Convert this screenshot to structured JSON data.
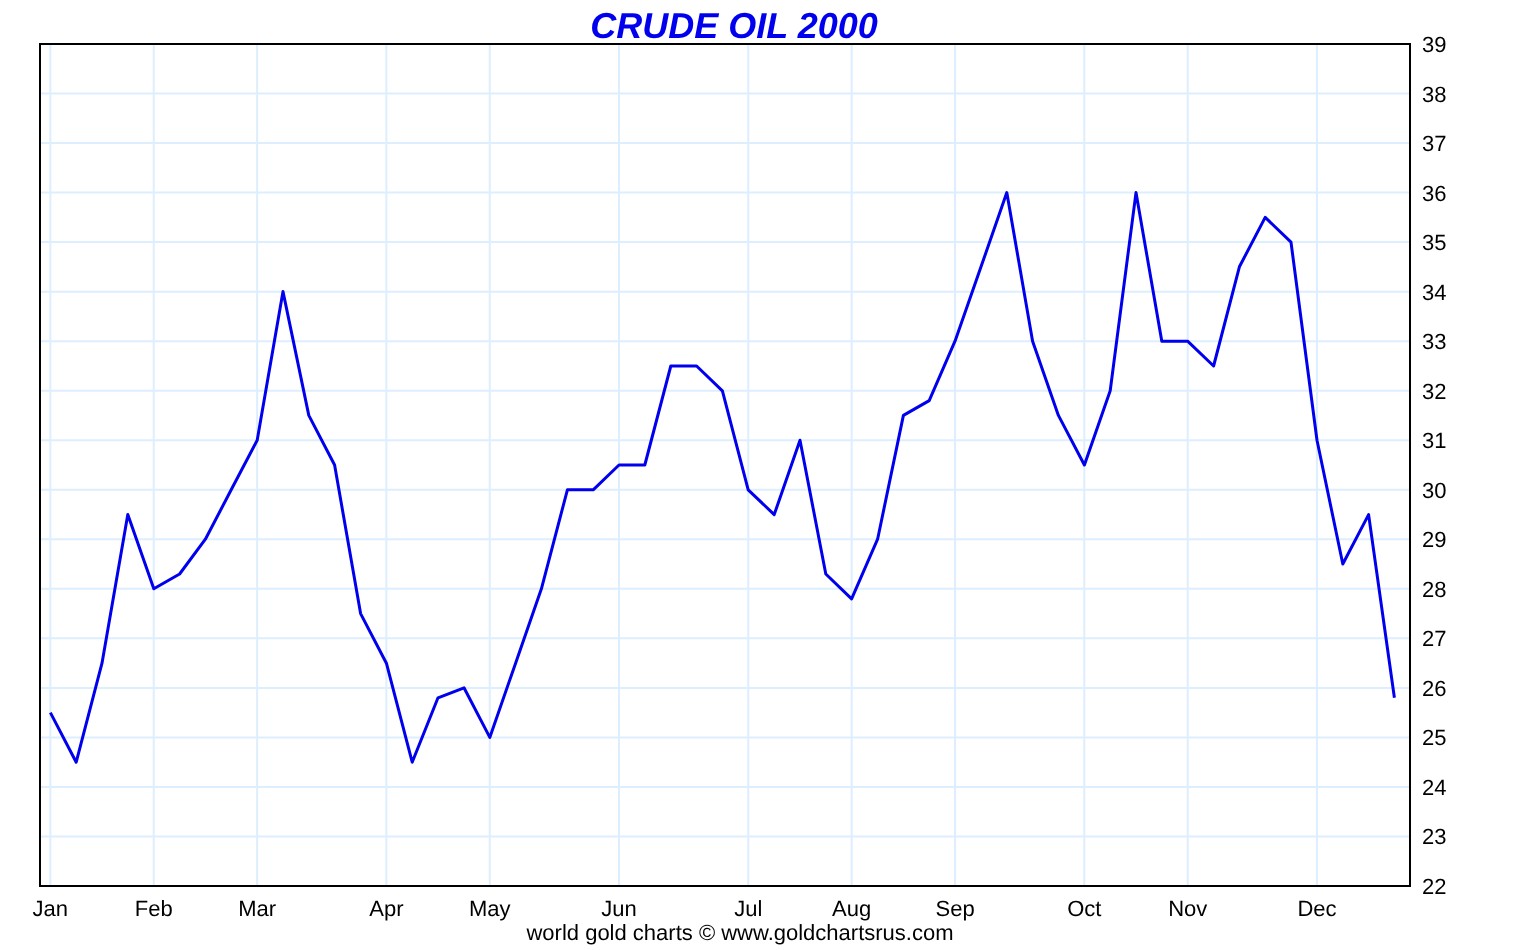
{
  "chart": {
    "chart_data": {
      "type": "line",
      "title": "CRUDE OIL 2000",
      "categories": [
        "Jan",
        null,
        null,
        null,
        "Feb",
        null,
        null,
        null,
        "Mar",
        null,
        null,
        null,
        null,
        "Apr",
        null,
        null,
        null,
        "May",
        null,
        null,
        null,
        null,
        "Jun",
        null,
        null,
        null,
        null,
        "Jul",
        null,
        null,
        null,
        "Aug",
        null,
        null,
        null,
        "Sep",
        null,
        null,
        null,
        null,
        "Oct",
        null,
        null,
        null,
        "Nov",
        null,
        null,
        null,
        null,
        "Dec",
        null,
        null,
        null
      ],
      "series": [
        {
          "color": "#0000ee",
          "values": [
            25.5,
            24.5,
            26.5,
            29.5,
            28,
            28.3,
            29,
            30,
            31,
            34,
            31.5,
            30.5,
            27.5,
            26.5,
            24.5,
            25.8,
            26,
            25,
            26.5,
            28,
            30,
            30,
            30.5,
            30.5,
            32.5,
            32.5,
            32,
            30,
            29.5,
            31,
            28.3,
            27.8,
            29,
            31.5,
            31.8,
            33,
            34.5,
            36,
            33,
            31.5,
            30.5,
            32,
            36,
            33,
            33,
            32.5,
            34.5,
            35.5,
            35,
            31,
            28.5,
            29.5,
            25.8
          ]
        }
      ],
      "ylim": [
        22,
        39
      ],
      "grid": true,
      "yticks": [
        22,
        23,
        24,
        25,
        26,
        27,
        28,
        29,
        30,
        31,
        32,
        33,
        34,
        35,
        36,
        37,
        38,
        39
      ]
    },
    "credit": "world gold charts © www.goldchartsrus.com"
  }
}
